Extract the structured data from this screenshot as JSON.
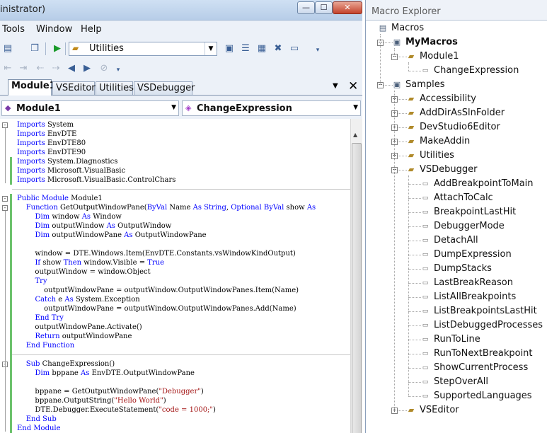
{
  "window": {
    "title": "inistrator)",
    "minimize_glyph": "—",
    "maximize_glyph": "☐",
    "close_glyph": "✕"
  },
  "menu": [
    "Tools",
    "Window",
    "Help"
  ],
  "toolbar": {
    "config_value": "Utilities"
  },
  "doc_tabs": [
    {
      "label": "Module1",
      "active": true
    },
    {
      "label": "VSEditor",
      "active": false
    },
    {
      "label": "Utilities",
      "active": false
    },
    {
      "label": "VSDebugger",
      "active": false
    }
  ],
  "nav": {
    "class_combo": "Module1",
    "member_combo": "ChangeExpression"
  },
  "code": [
    [
      [
        "kw",
        "Imports"
      ],
      [
        "t",
        " System"
      ]
    ],
    [
      [
        "kw",
        "Imports"
      ],
      [
        "t",
        " EnvDTE"
      ]
    ],
    [
      [
        "kw",
        "Imports"
      ],
      [
        "t",
        " EnvDTE80"
      ]
    ],
    [
      [
        "kw",
        "Imports"
      ],
      [
        "t",
        " EnvDTE90"
      ]
    ],
    [
      [
        "kw",
        "Imports"
      ],
      [
        "t",
        " System.Diagnostics"
      ]
    ],
    [
      [
        "kw",
        "Imports"
      ],
      [
        "t",
        " Microsoft.VisualBasic"
      ]
    ],
    [
      [
        "kw",
        "Imports"
      ],
      [
        "t",
        " Microsoft.VisualBasic.ControlChars"
      ]
    ],
    [],
    [
      [
        "kw",
        "Public Module"
      ],
      [
        "t",
        " Module1"
      ]
    ],
    [
      [
        "t",
        "    "
      ],
      [
        "kw",
        "Function"
      ],
      [
        "t",
        " GetOutputWindowPane("
      ],
      [
        "kw",
        "ByVal"
      ],
      [
        "t",
        " Name "
      ],
      [
        "kw",
        "As String"
      ],
      [
        "t",
        ", "
      ],
      [
        "kw",
        "Optional ByVal"
      ],
      [
        "t",
        " show "
      ],
      [
        "kw",
        "As"
      ]
    ],
    [
      [
        "t",
        "        "
      ],
      [
        "kw",
        "Dim"
      ],
      [
        "t",
        " window "
      ],
      [
        "kw",
        "As"
      ],
      [
        "t",
        " Window"
      ]
    ],
    [
      [
        "t",
        "        "
      ],
      [
        "kw",
        "Dim"
      ],
      [
        "t",
        " outputWindow "
      ],
      [
        "kw",
        "As"
      ],
      [
        "t",
        " OutputWindow"
      ]
    ],
    [
      [
        "t",
        "        "
      ],
      [
        "kw",
        "Dim"
      ],
      [
        "t",
        " outputWindowPane "
      ],
      [
        "kw",
        "As"
      ],
      [
        "t",
        " OutputWindowPane"
      ]
    ],
    [],
    [
      [
        "t",
        "        window = DTE.Windows.Item(EnvDTE.Constants.vsWindowKindOutput)"
      ]
    ],
    [
      [
        "t",
        "        "
      ],
      [
        "kw",
        "If"
      ],
      [
        "t",
        " show "
      ],
      [
        "kw",
        "Then"
      ],
      [
        "t",
        " window.Visible = "
      ],
      [
        "kw",
        "True"
      ]
    ],
    [
      [
        "t",
        "        outputWindow = window.Object"
      ]
    ],
    [
      [
        "t",
        "        "
      ],
      [
        "kw",
        "Try"
      ]
    ],
    [
      [
        "t",
        "            outputWindowPane = outputWindow.OutputWindowPanes.Item(Name)"
      ]
    ],
    [
      [
        "t",
        "        "
      ],
      [
        "kw",
        "Catch"
      ],
      [
        "t",
        " e "
      ],
      [
        "kw",
        "As"
      ],
      [
        "t",
        " System.Exception"
      ]
    ],
    [
      [
        "t",
        "            outputWindowPane = outputWindow.OutputWindowPanes.Add(Name)"
      ]
    ],
    [
      [
        "t",
        "        "
      ],
      [
        "kw",
        "End Try"
      ]
    ],
    [
      [
        "t",
        "        outputWindowPane.Activate()"
      ]
    ],
    [
      [
        "t",
        "        "
      ],
      [
        "kw",
        "Return"
      ],
      [
        "t",
        " outputWindowPane"
      ]
    ],
    [
      [
        "t",
        "    "
      ],
      [
        "kw",
        "End Function"
      ]
    ],
    [],
    [
      [
        "t",
        "    "
      ],
      [
        "kw",
        "Sub"
      ],
      [
        "t",
        " ChangeExpression()"
      ]
    ],
    [
      [
        "t",
        "        "
      ],
      [
        "kw",
        "Dim"
      ],
      [
        "t",
        " bppane "
      ],
      [
        "kw",
        "As"
      ],
      [
        "t",
        " EnvDTE.OutputWindowPane"
      ]
    ],
    [],
    [
      [
        "t",
        "        bppane = GetOutputWindowPane("
      ],
      [
        "str",
        "\"Debugger\""
      ],
      [
        "t",
        ")"
      ]
    ],
    [
      [
        "t",
        "        bppane.OutputString("
      ],
      [
        "str",
        "\"Hello World\""
      ],
      [
        "t",
        ")"
      ]
    ],
    [
      [
        "t",
        "        DTE.Debugger.ExecuteStatement("
      ],
      [
        "str",
        "\"code = 1000;\""
      ],
      [
        "t",
        ")"
      ]
    ],
    [
      [
        "t",
        "    "
      ],
      [
        "kw",
        "End Sub"
      ]
    ],
    [
      [
        "kw",
        "End Module"
      ]
    ]
  ],
  "macro_explorer": {
    "title": "Macro Explorer",
    "tree": [
      {
        "label": "Macros",
        "level": 0,
        "icon": "macros-root-icon",
        "expander": ""
      },
      {
        "label": "MyMacros",
        "level": 1,
        "icon": "project-icon",
        "expander": "minus",
        "bold": true
      },
      {
        "label": "Module1",
        "level": 2,
        "icon": "module-icon",
        "expander": "minus"
      },
      {
        "label": "ChangeExpression",
        "level": 3,
        "icon": "macro-icon",
        "expander": ""
      },
      {
        "label": "Samples",
        "level": 1,
        "icon": "project-icon",
        "expander": "minus"
      },
      {
        "label": "Accessibility",
        "level": 2,
        "icon": "module-icon",
        "expander": "plus"
      },
      {
        "label": "AddDirAsSlnFolder",
        "level": 2,
        "icon": "module-icon",
        "expander": "plus"
      },
      {
        "label": "DevStudio6Editor",
        "level": 2,
        "icon": "module-icon",
        "expander": "plus"
      },
      {
        "label": "MakeAddin",
        "level": 2,
        "icon": "module-icon",
        "expander": "plus"
      },
      {
        "label": "Utilities",
        "level": 2,
        "icon": "module-icon",
        "expander": "plus"
      },
      {
        "label": "VSDebugger",
        "level": 2,
        "icon": "module-icon",
        "expander": "minus"
      },
      {
        "label": "AddBreakpointToMain",
        "level": 3,
        "icon": "macro-icon",
        "expander": ""
      },
      {
        "label": "AttachToCalc",
        "level": 3,
        "icon": "macro-icon",
        "expander": ""
      },
      {
        "label": "BreakpointLastHit",
        "level": 3,
        "icon": "macro-icon",
        "expander": ""
      },
      {
        "label": "DebuggerMode",
        "level": 3,
        "icon": "macro-icon",
        "expander": ""
      },
      {
        "label": "DetachAll",
        "level": 3,
        "icon": "macro-icon",
        "expander": ""
      },
      {
        "label": "DumpExpression",
        "level": 3,
        "icon": "macro-icon",
        "expander": ""
      },
      {
        "label": "DumpStacks",
        "level": 3,
        "icon": "macro-icon",
        "expander": ""
      },
      {
        "label": "LastBreakReason",
        "level": 3,
        "icon": "macro-icon",
        "expander": ""
      },
      {
        "label": "ListAllBreakpoints",
        "level": 3,
        "icon": "macro-icon",
        "expander": ""
      },
      {
        "label": "ListBreakpointsLastHit",
        "level": 3,
        "icon": "macro-icon",
        "expander": ""
      },
      {
        "label": "ListDebuggedProcesses",
        "level": 3,
        "icon": "macro-icon",
        "expander": ""
      },
      {
        "label": "RunToLine",
        "level": 3,
        "icon": "macro-icon",
        "expander": ""
      },
      {
        "label": "RunToNextBreakpoint",
        "level": 3,
        "icon": "macro-icon",
        "expander": ""
      },
      {
        "label": "ShowCurrentProcess",
        "level": 3,
        "icon": "macro-icon",
        "expander": ""
      },
      {
        "label": "StepOverAll",
        "level": 3,
        "icon": "macro-icon",
        "expander": ""
      },
      {
        "label": "SupportedLanguages",
        "level": 3,
        "icon": "macro-icon",
        "expander": ""
      },
      {
        "label": "VSEditor",
        "level": 2,
        "icon": "module-icon",
        "expander": "plus"
      }
    ]
  },
  "colors": {
    "keyword": "#0000ff",
    "string": "#a31515",
    "changed_margin": "#6cc26c"
  }
}
